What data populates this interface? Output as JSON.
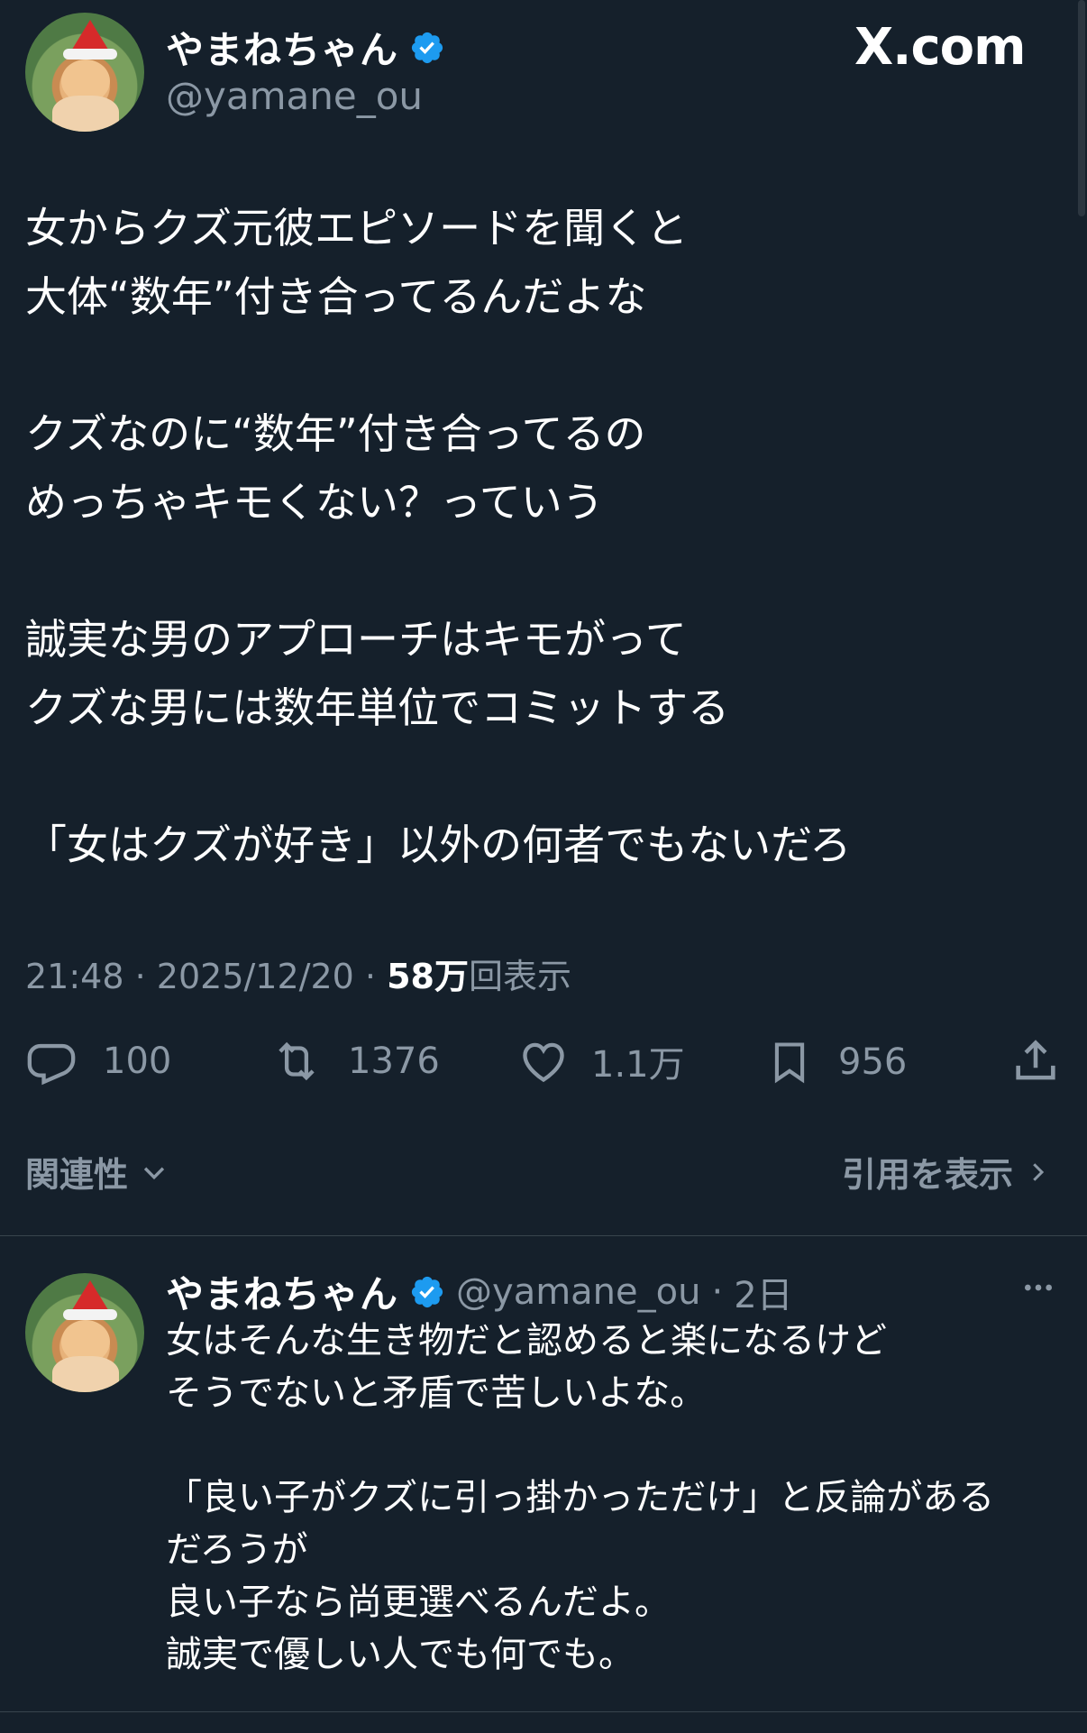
{
  "tweet": {
    "author_name": "やまねちゃん",
    "author_handle": "@yamane_ou",
    "site_badge": "X.com",
    "text": "女からクズ元彼エピソードを聞くと\n大体“数年”付き合ってるんだよな\n\nクズなのに“数年”付き合ってるの\nめっちゃキモくない？っていう\n\n誠実な男のアプローチはキモがって\nクズな男には数年単位でコミットする\n\n「女はクズが好き」以外の何者でもないだろ",
    "time": "21:48",
    "date": "2025/12/20",
    "views_value": "58万",
    "views_label": "回表示",
    "sep": "·"
  },
  "actions": {
    "replies": "100",
    "retweets": "1376",
    "likes": "1.1万",
    "bookmarks": "956"
  },
  "filters": {
    "sort_label": "関連性",
    "quotes_label": "引用を表示"
  },
  "reply": {
    "author_name": "やまねちゃん",
    "author_handle": "@yamane_ou",
    "age": "2日",
    "sep": "·",
    "text": "女はそんな生き物だと認めると楽になるけど\nそうでないと矛盾で苦しいよな。\n\n「良い子がクズに引っ掛かっただけ」と反論がある\nだろうが\n良い子なら尚更選べるんだよ。\n誠実で優しい人でも何でも。"
  },
  "colors": {
    "background": "#15202b",
    "verified": "#1d9bf0",
    "secondary_text": "#8b98a5"
  }
}
